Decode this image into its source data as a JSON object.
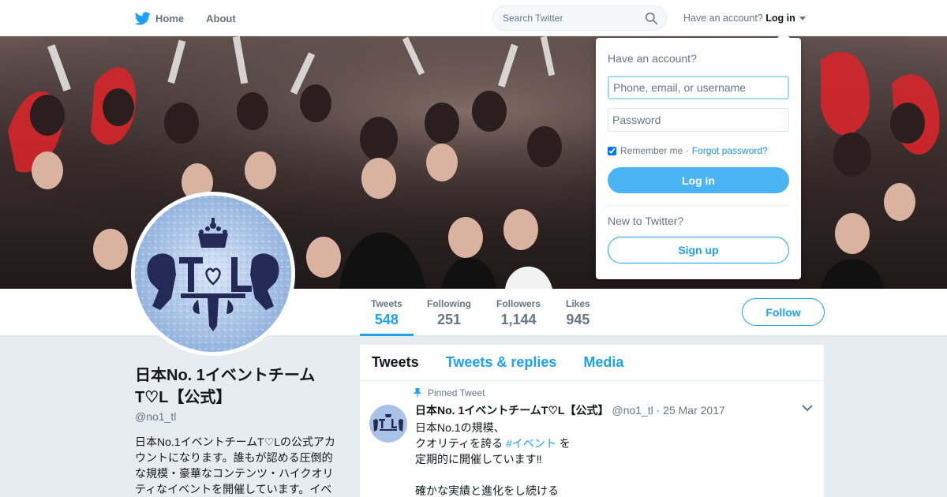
{
  "nav": {
    "home_label": "Home",
    "about_label": "About",
    "search_placeholder": "Search Twitter",
    "have_account_text": "Have an account?",
    "login_label": "Log in"
  },
  "profile_nav": {
    "tweets_label": "Tweets",
    "tweets_count": "548",
    "following_label": "Following",
    "following_count": "251",
    "followers_label": "Followers",
    "followers_count": "1,144",
    "likes_label": "Likes",
    "likes_count": "945",
    "follow_label": "Follow"
  },
  "avatar": {
    "logo_text": "T♡L"
  },
  "profile": {
    "name": "日本No. 1イベントチームT♡L【公式】",
    "handle": "@no1_tl",
    "bio": "日本No.1イベントチームT♡Lの公式アカウントになります。誰もが認める圧倒的な規模・豪華なコンテンツ・ハイクオリティなイベントを開催しています。イベ"
  },
  "timeline": {
    "tabs": [
      "Tweets",
      "Tweets & replies",
      "Media"
    ],
    "pinned_label": "Pinned Tweet",
    "tweet": {
      "name": "日本No. 1イベントチームT♡L【公式】",
      "handle": "@no1_tl",
      "date": "· 25 Mar 2017",
      "line1": "日本No.1の規模、",
      "line2_pre": "クオリティを誇る",
      "line2_hashtag": "#イベント",
      "line2_post": " を",
      "line3": "定期的に開催しています‼",
      "line5": "確かな実績と進化をし続ける"
    }
  },
  "login_dropdown": {
    "heading": "Have an account?",
    "username_placeholder": "Phone, email, or username",
    "password_placeholder": "Password",
    "remember_label": "Remember me ·",
    "forgot_label": "Forgot password?",
    "login_button": "Log in",
    "new_text": "New to Twitter?",
    "signup_button": "Sign up"
  },
  "colors": {
    "accent": "#1da1f2",
    "login_button": "#4ab3f4",
    "page_bg": "#e6ecf0"
  }
}
